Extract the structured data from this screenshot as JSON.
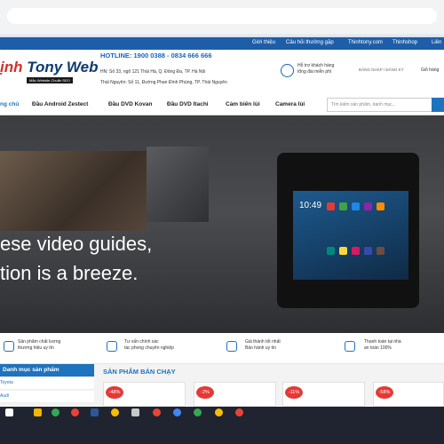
{
  "topnav": [
    "Giới thiệu",
    "Câu hỏi thường gặp",
    "Thinhtony.com",
    "Thinhshop",
    "Liên"
  ],
  "header": {
    "logo_accent": "ịnh",
    "logo_rest": " Tony Web",
    "tagline": "Mẫu Website Chuẩn SEO",
    "hotline": "HOTLINE: 1900 0388 - 0834 666 666",
    "addr1": "HN: Số 33, ngõ 121 Thái Hà, Q. Đống Đa, TP. Hà Nội",
    "addr2": "Thái Nguyên: Số 11, Đường Phan Đình Phùng, TP. Thái Nguyên",
    "support1": "Hỗ trợ khách hàng",
    "support2": "tổng đài miễn phí",
    "login": "ĐĂNG NHẬP / ĐĂNG KÝ",
    "cart": "Giỏ hàng"
  },
  "menu": [
    "ng chủ",
    "Đầu Android Zestect",
    "Đầu DVD Kovan",
    "Đầu DVD Itachi",
    "Cảm biến lùi",
    "Camera lùi"
  ],
  "search_placeholder": "Tìm kiếm sản phẩm, danh mục...",
  "hero": {
    "line1": "ese video guides,",
    "line2": "tion is a breeze.",
    "clock": "10:49"
  },
  "features": [
    {
      "l1": "Sản phẩm chất lượng",
      "l2": "thương hiệu uy tín"
    },
    {
      "l1": "Tư vấn chính xác",
      "l2": "tác phong chuyên nghiệp"
    },
    {
      "l1": "Giá thành tốt nhất",
      "l2": "Bảo hành uy tín"
    },
    {
      "l1": "Thanh toán tại nhà",
      "l2": "an toàn 100%"
    }
  ],
  "categories": {
    "title": "Danh mục sản phẩm",
    "items": [
      "Toyota",
      "Audi"
    ]
  },
  "bestseller": "SẢN PHẨM BÁN CHẠY",
  "products": [
    {
      "discount": "-48%"
    },
    {
      "discount": "-2%"
    },
    {
      "discount": "-11%"
    },
    {
      "discount": "-58%"
    }
  ],
  "colors": {
    "brand": "#1e73be",
    "dark_brand": "#1e5ea8",
    "sale": "#e53935"
  }
}
